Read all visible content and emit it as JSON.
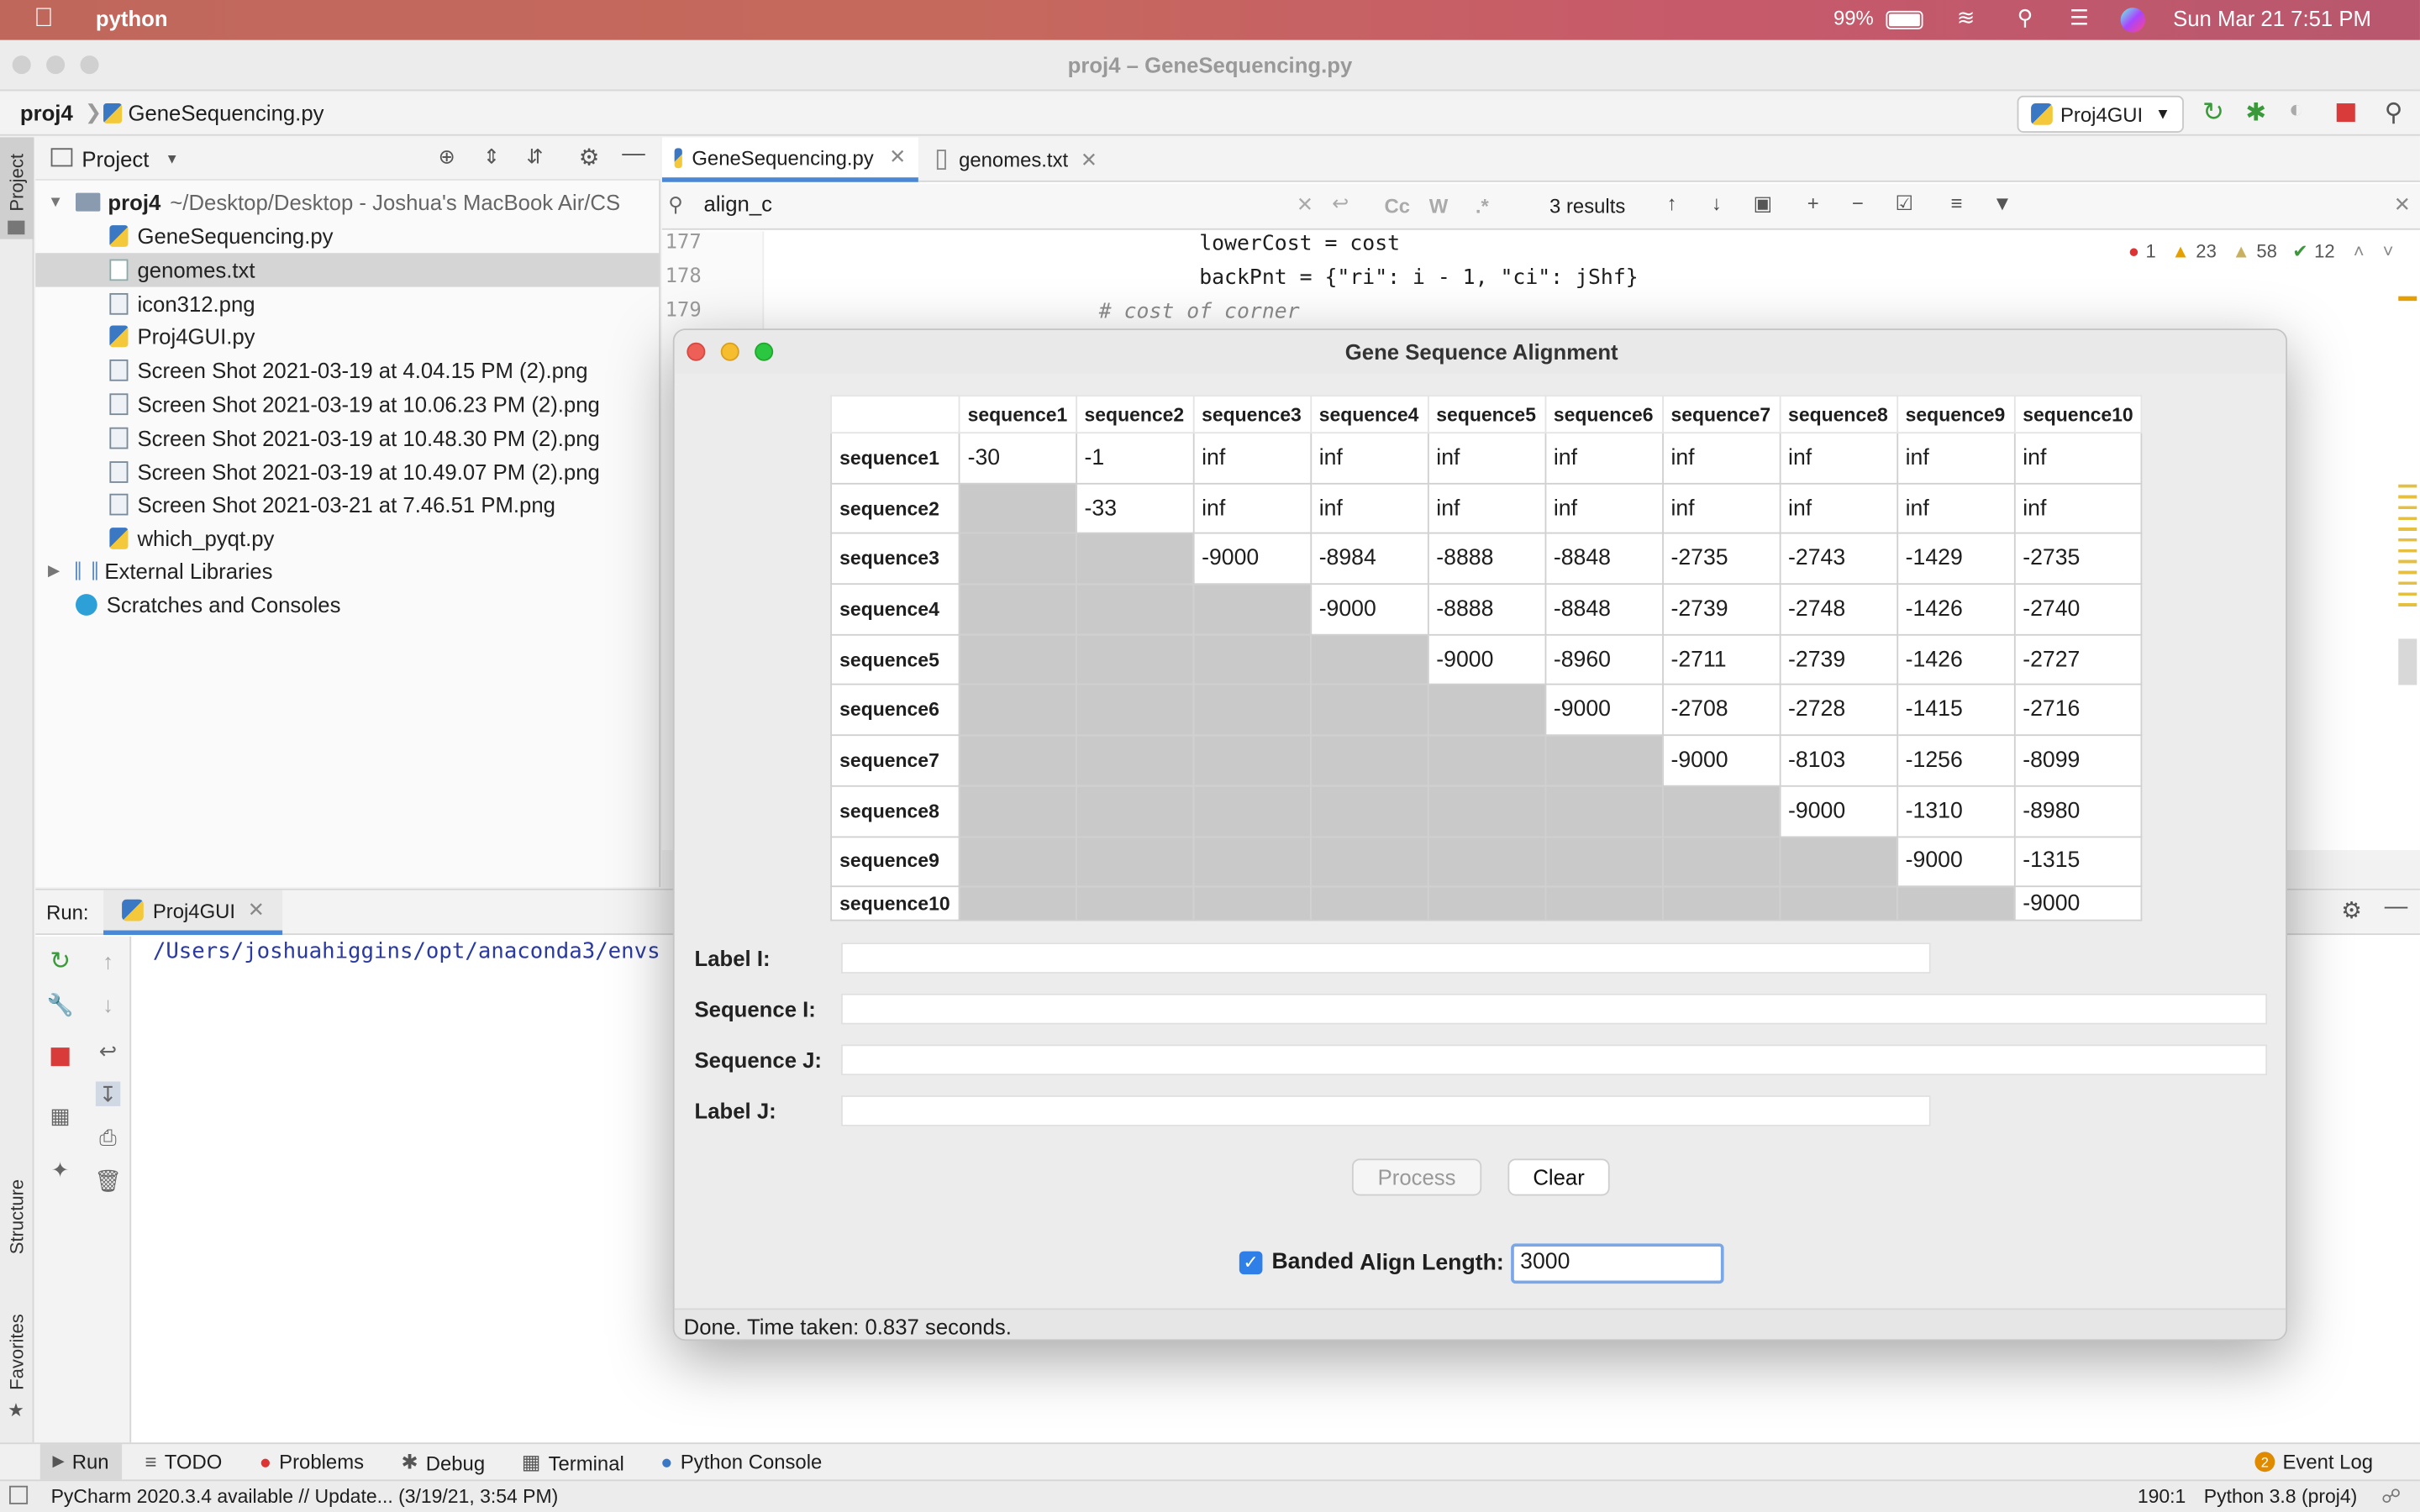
{
  "menubar": {
    "app_name": "python",
    "battery": "99%",
    "datetime": "Sun Mar 21  7:51 PM"
  },
  "window": {
    "title": "proj4 – GeneSequencing.py"
  },
  "navbar": {
    "project": "proj4",
    "file": "GeneSequencing.py",
    "run_config": "Proj4GUI"
  },
  "side_stripe": {
    "project": "Project",
    "structure": "Structure",
    "favorites": "Favorites"
  },
  "project_panel": {
    "header": "Project",
    "root": "proj4",
    "root_path": "~/Desktop/Desktop - Joshua's MacBook Air/CS",
    "files": [
      "GeneSequencing.py",
      "genomes.txt",
      "icon312.png",
      "Proj4GUI.py",
      "Screen Shot 2021-03-19 at 4.04.15 PM (2).png",
      "Screen Shot 2021-03-19 at 10.06.23 PM (2).png",
      "Screen Shot 2021-03-19 at 10.48.30 PM (2).png",
      "Screen Shot 2021-03-19 at 10.49.07 PM (2).png",
      "Screen Shot 2021-03-21 at 7.46.51 PM.png",
      "which_pyqt.py"
    ],
    "external": "External Libraries",
    "scratches": "Scratches and Consoles"
  },
  "editor": {
    "tabs": [
      "GeneSequencing.py",
      "genomes.txt"
    ],
    "find_query": "align_c",
    "find_opts": [
      "Cc",
      "W",
      ".*"
    ],
    "results": "3 results",
    "inspections": {
      "errors": "1",
      "warnings": "23",
      "weak": "58",
      "ok": "12"
    },
    "lines": [
      {
        "num": "177",
        "code": "                lowerCost = cost"
      },
      {
        "num": "178",
        "code": "                backPnt = {\"ri\": i - 1, \"ci\": jShf}"
      },
      {
        "num": "179",
        "code": "        # cost of corner"
      }
    ]
  },
  "run_panel": {
    "label": "Run:",
    "tab": "Proj4GUI",
    "output": "/Users/joshuahiggins/opt/anaconda3/envs"
  },
  "dialog": {
    "title": "Gene Sequence Alignment",
    "columns": [
      "sequence1",
      "sequence2",
      "sequence3",
      "sequence4",
      "sequence5",
      "sequence6",
      "sequence7",
      "sequence8",
      "sequence9",
      "sequence10"
    ],
    "rows": [
      {
        "label": "sequence1",
        "cells": [
          "-30",
          "-1",
          "inf",
          "inf",
          "inf",
          "inf",
          "inf",
          "inf",
          "inf",
          "inf"
        ]
      },
      {
        "label": "sequence2",
        "cells": [
          "",
          "-33",
          "inf",
          "inf",
          "inf",
          "inf",
          "inf",
          "inf",
          "inf",
          "inf"
        ]
      },
      {
        "label": "sequence3",
        "cells": [
          "",
          "",
          "-9000",
          "-8984",
          "-8888",
          "-8848",
          "-2735",
          "-2743",
          "-1429",
          "-2735"
        ]
      },
      {
        "label": "sequence4",
        "cells": [
          "",
          "",
          "",
          "-9000",
          "-8888",
          "-8848",
          "-2739",
          "-2748",
          "-1426",
          "-2740"
        ]
      },
      {
        "label": "sequence5",
        "cells": [
          "",
          "",
          "",
          "",
          "-9000",
          "-8960",
          "-2711",
          "-2739",
          "-1426",
          "-2727"
        ]
      },
      {
        "label": "sequence6",
        "cells": [
          "",
          "",
          "",
          "",
          "",
          "-9000",
          "-2708",
          "-2728",
          "-1415",
          "-2716"
        ]
      },
      {
        "label": "sequence7",
        "cells": [
          "",
          "",
          "",
          "",
          "",
          "",
          "-9000",
          "-8103",
          "-1256",
          "-8099"
        ]
      },
      {
        "label": "sequence8",
        "cells": [
          "",
          "",
          "",
          "",
          "",
          "",
          "",
          "-9000",
          "-1310",
          "-8980"
        ]
      },
      {
        "label": "sequence9",
        "cells": [
          "",
          "",
          "",
          "",
          "",
          "",
          "",
          "",
          "-9000",
          "-1315"
        ]
      },
      {
        "label": "sequence10",
        "cells": [
          "",
          "",
          "",
          "",
          "",
          "",
          "",
          "",
          "",
          "-9000"
        ]
      }
    ],
    "label_i": "Label I:",
    "sequence_i": "Sequence I:",
    "sequence_j": "Sequence J:",
    "label_j": "Label J:",
    "process": "Process",
    "clear": "Clear",
    "banded": "Banded",
    "align_length_label": "Align Length:",
    "align_length_value": "3000",
    "status": "Done.  Time taken: 0.837 seconds."
  },
  "bottom_tabs": [
    "Run",
    "TODO",
    "Problems",
    "Debug",
    "Terminal",
    "Python Console"
  ],
  "event_log": {
    "count": "2",
    "label": "Event Log"
  },
  "statusbar": {
    "message": "PyCharm 2020.3.4 available // Update... (3/19/21, 3:54 PM)",
    "position": "190:1",
    "interpreter": "Python 3.8 (proj4)"
  }
}
